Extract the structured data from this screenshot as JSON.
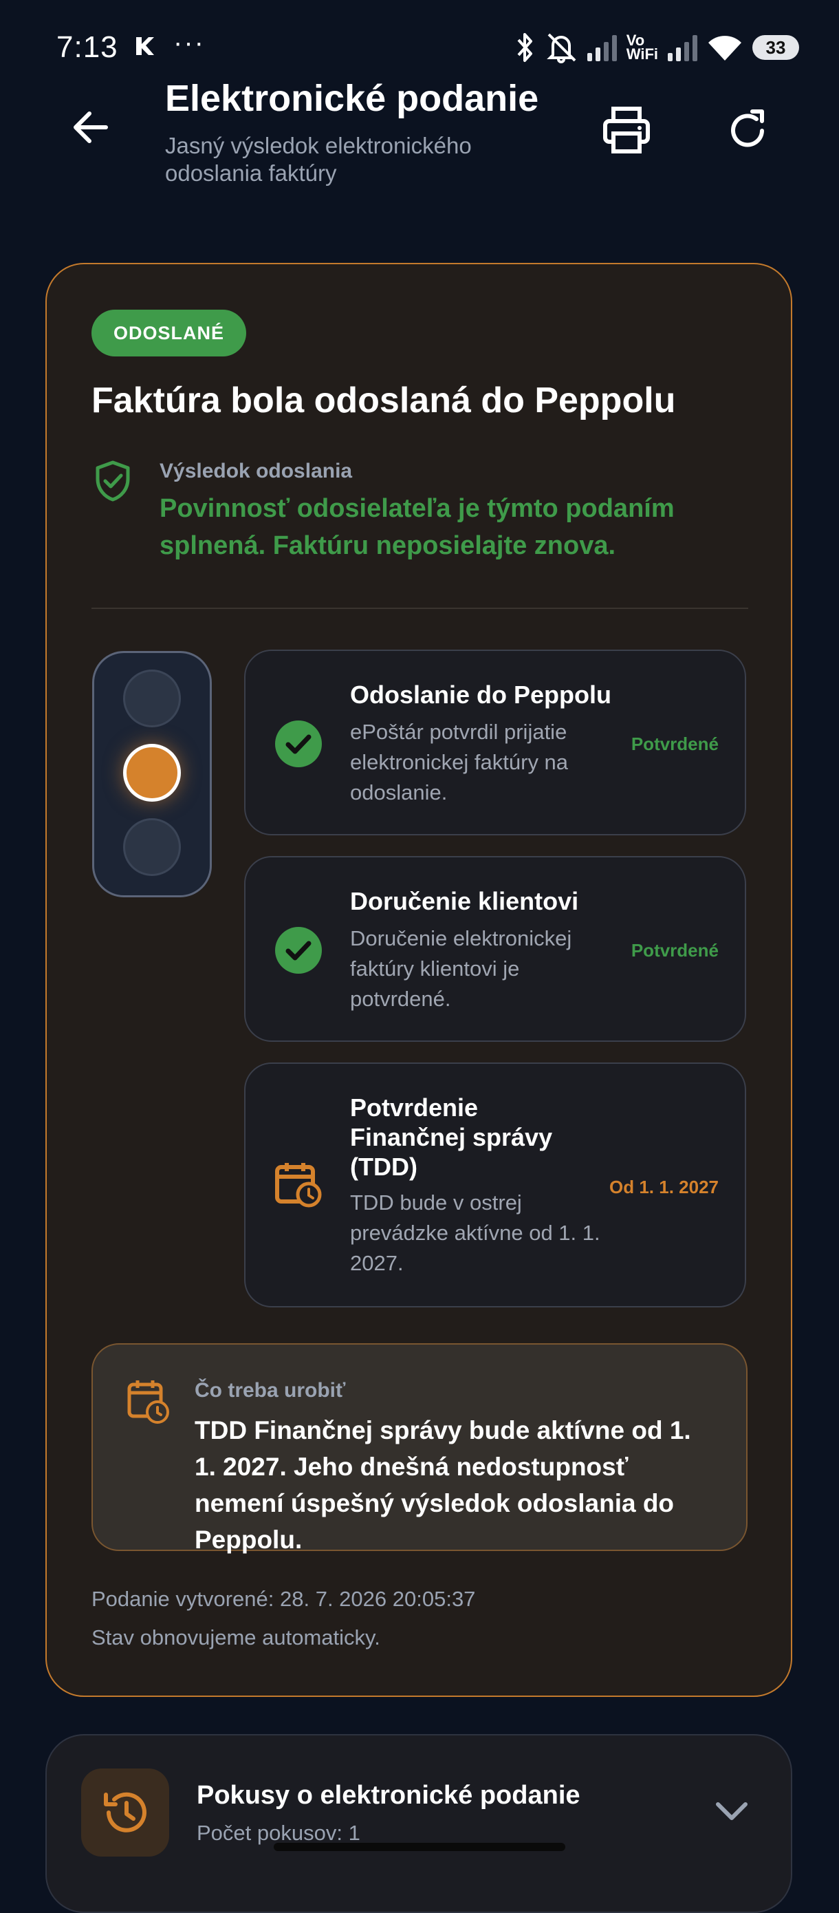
{
  "status_bar": {
    "time": "7:13",
    "more": "···",
    "vowifi_top": "Vo",
    "vowifi_bottom": "WiFi",
    "battery": "33",
    "icons": [
      "k-app-icon",
      "bluetooth-icon",
      "mute-icon",
      "signal-icon",
      "wifi-icon",
      "battery-icon"
    ]
  },
  "app_bar": {
    "title": "Elektronické podanie",
    "subtitle": "Jasný výsledok elektronického odoslania faktúry",
    "icons": [
      "back-arrow-icon",
      "printer-icon",
      "refresh-icon"
    ]
  },
  "card": {
    "badge": "ODOSLANÉ",
    "title": "Faktúra bola odoslaná do Peppolu",
    "result_label": "Výsledok odoslania",
    "result_text": "Povinnosť odosielateľa je týmto podaním splnená. Faktúru neposielajte znova."
  },
  "traffic_light": {
    "active_lamp": 2,
    "lamp_count": 3
  },
  "steps": [
    {
      "title": "Odoslanie do Peppolu",
      "description": "ePoštár potvrdil prijatie elektronickej faktúry na odoslanie.",
      "status": "Potvrdené",
      "icon": "check-circle-icon"
    },
    {
      "title": "Doručenie klientovi",
      "description": "Doručenie elektronickej faktúry klientovi je potvrdené.",
      "status": "Potvrdené",
      "icon": "check-circle-icon"
    },
    {
      "title": "Potvrdenie Finančnej správy (TDD)",
      "description": "TDD bude v ostrej prevádzke aktívne od 1. 1. 2027.",
      "status": "Od 1. 1. 2027",
      "icon": "calendar-clock-icon"
    }
  ],
  "todo": {
    "label": "Čo treba urobiť",
    "text": "TDD Finančnej správy bude aktívne od 1. 1. 2027. Jeho dnešná nedostupnosť nemení úspešný výsledok odoslania do Peppolu."
  },
  "meta": {
    "created": "Podanie vytvorené: 28. 7. 2026 20:05:37",
    "auto_refresh": "Stav obnovujeme automaticky."
  },
  "attempts": {
    "title": "Pokusy o elektronické podanie",
    "count_label": "Počet pokusov: 1"
  },
  "colors": {
    "background": "#0b1220",
    "accent_orange": "#d5822c",
    "success_green": "#3f9b4a",
    "card_bg": "#221d1a"
  }
}
